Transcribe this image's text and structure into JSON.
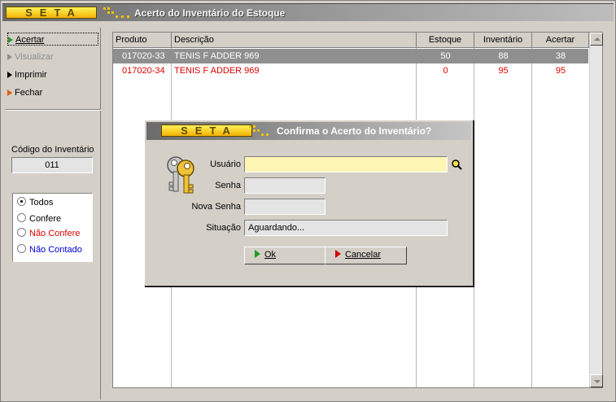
{
  "window": {
    "logo": "SETA",
    "title": "Acerto do Inventário do Estoque"
  },
  "sidebar": {
    "menu": [
      {
        "label": "Acertar",
        "icon": "green-triangle-icon",
        "state": "focused"
      },
      {
        "label": "Visualizar",
        "icon": "gray-triangle-icon",
        "state": "disabled"
      },
      {
        "label": "Imprimir",
        "icon": "black-triangle-icon",
        "state": "normal"
      },
      {
        "label": "Fechar",
        "icon": "orange-triangle-icon",
        "state": "normal"
      }
    ],
    "code_label": "Código do Inventário",
    "code_value": "011",
    "filters": [
      {
        "label": "Todos",
        "selected": true,
        "color": "#000000"
      },
      {
        "label": "Confere",
        "selected": false,
        "color": "#000000"
      },
      {
        "label": "Não Confere",
        "selected": false,
        "color": "#e00000"
      },
      {
        "label": "Não Contado",
        "selected": false,
        "color": "#0000e0"
      }
    ]
  },
  "grid": {
    "columns": [
      "Produto",
      "Descrição",
      "Estoque",
      "Inventário",
      "Acertar"
    ],
    "rows": [
      {
        "produto": "017020-33",
        "descricao": "TENIS F ADDER 969",
        "estoque": "50",
        "inventario": "88",
        "acertar": "38",
        "selected": true,
        "color": "#ffffff"
      },
      {
        "produto": "017020-34",
        "descricao": "TENIS F ADDER 969",
        "estoque": "0",
        "inventario": "95",
        "acertar": "95",
        "selected": false,
        "color": "#e00000"
      }
    ]
  },
  "dialog": {
    "logo": "SETA",
    "title": "Confirma o Acerto do Inventário?",
    "fields": {
      "usuario_label": "Usuário",
      "usuario_value": "",
      "senha_label": "Senha",
      "senha_value": "",
      "nova_senha_label": "Nova Senha",
      "nova_senha_value": "",
      "situacao_label": "Situação",
      "situacao_value": "Aguardando..."
    },
    "ok_label": "Ok",
    "cancel_label": "Cancelar"
  },
  "colors": {
    "accent_yellow": "#f3b200",
    "selected_row": "#8f8f8f",
    "highlight_input": "#fdf6b5"
  }
}
